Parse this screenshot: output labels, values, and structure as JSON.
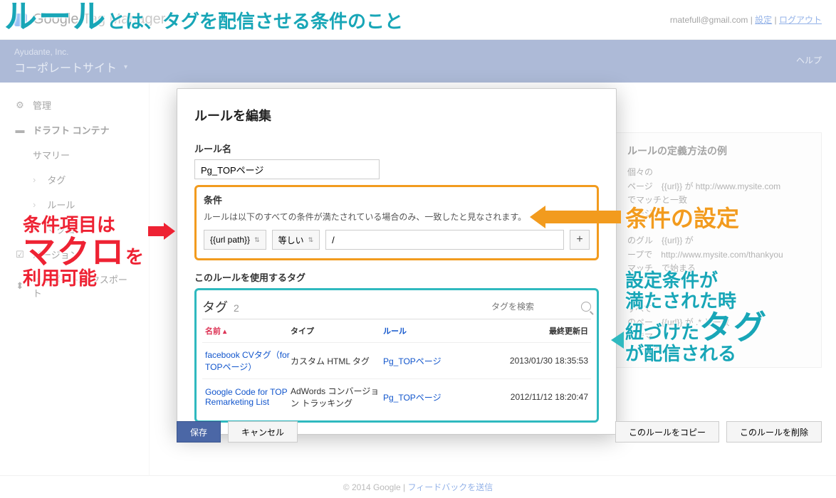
{
  "header": {
    "logo_main": "Google",
    "logo_sub": "Tag Manager",
    "email": "rnatefull@gmail.com",
    "settings": "設定",
    "logout": "ログアウト"
  },
  "bluebar": {
    "company": "Ayudante, Inc.",
    "site": "コーポレートサイト",
    "help": "ヘルプ"
  },
  "sidebar": {
    "manage": "管理",
    "draft": "ドラフト コンテナ",
    "summary": "サマリー",
    "tags": "タグ",
    "rules": "ルール",
    "macros": "マクロ",
    "versions": "バージョン",
    "import": "インポート/エクスポート"
  },
  "modal": {
    "title": "ルールを編集",
    "name_label": "ルール名",
    "name_value": "Pg_TOPページ",
    "cond_label": "条件",
    "cond_desc": "ルールは以下のすべての条件が満たされている場合のみ、一致したと見なされます。",
    "macro_value": "{{url path}}",
    "op_value": "等しい",
    "match_value": "/",
    "tags_caption": "このルールを使用するタグ",
    "tag_heading": "タグ",
    "tag_count": "2",
    "search_placeholder": "タグを検索",
    "cols": {
      "name": "名前",
      "type": "タイプ",
      "rule": "ルール",
      "updated": "最終更新日"
    },
    "rows": [
      {
        "name": "facebook CVタグ（for TOPページ）",
        "type": "カスタム HTML タグ",
        "rule": "Pg_TOPページ",
        "updated": "2013/01/30 18:35:53"
      },
      {
        "name": "Google Code for TOP Remarketing List",
        "type": "AdWords コンバージョン トラッキング",
        "rule": "Pg_TOPページ",
        "updated": "2012/11/12 18:20:47"
      }
    ]
  },
  "buttons": {
    "save": "保存",
    "cancel": "キャンセル",
    "copy": "このルールをコピー",
    "delete": "このルールを削除"
  },
  "right_help": {
    "title": "ルールの定義方法の例",
    "body": "個々の\nページ {{url}} が http://www.mysite.com\nでマッチと一致\nページ\n\nのグル {{url}} が\nープで http://www.mysite.com/thankyou\nマッチ で始まる\nング\n\nすべて\nのペー {{url}} が .* と一致\nジでマ\nッチング"
  },
  "footer": {
    "copyright": "© 2014 Google |",
    "feedback": "フィードバックを送信"
  },
  "annotations": {
    "top": {
      "rule": "ルール",
      "rest": "とは、タグを配信させる条件のこと"
    },
    "left": {
      "l1": "条件項目は",
      "l2": "マクロ",
      "l2b": "を",
      "l3": "利用可能"
    },
    "cond": "条件の設定",
    "tags": {
      "l1": "設定条件が",
      "l2": "満たされた時",
      "l3a": "紐づけた",
      "l3b": "タグ",
      "l4": "が配信される"
    }
  }
}
